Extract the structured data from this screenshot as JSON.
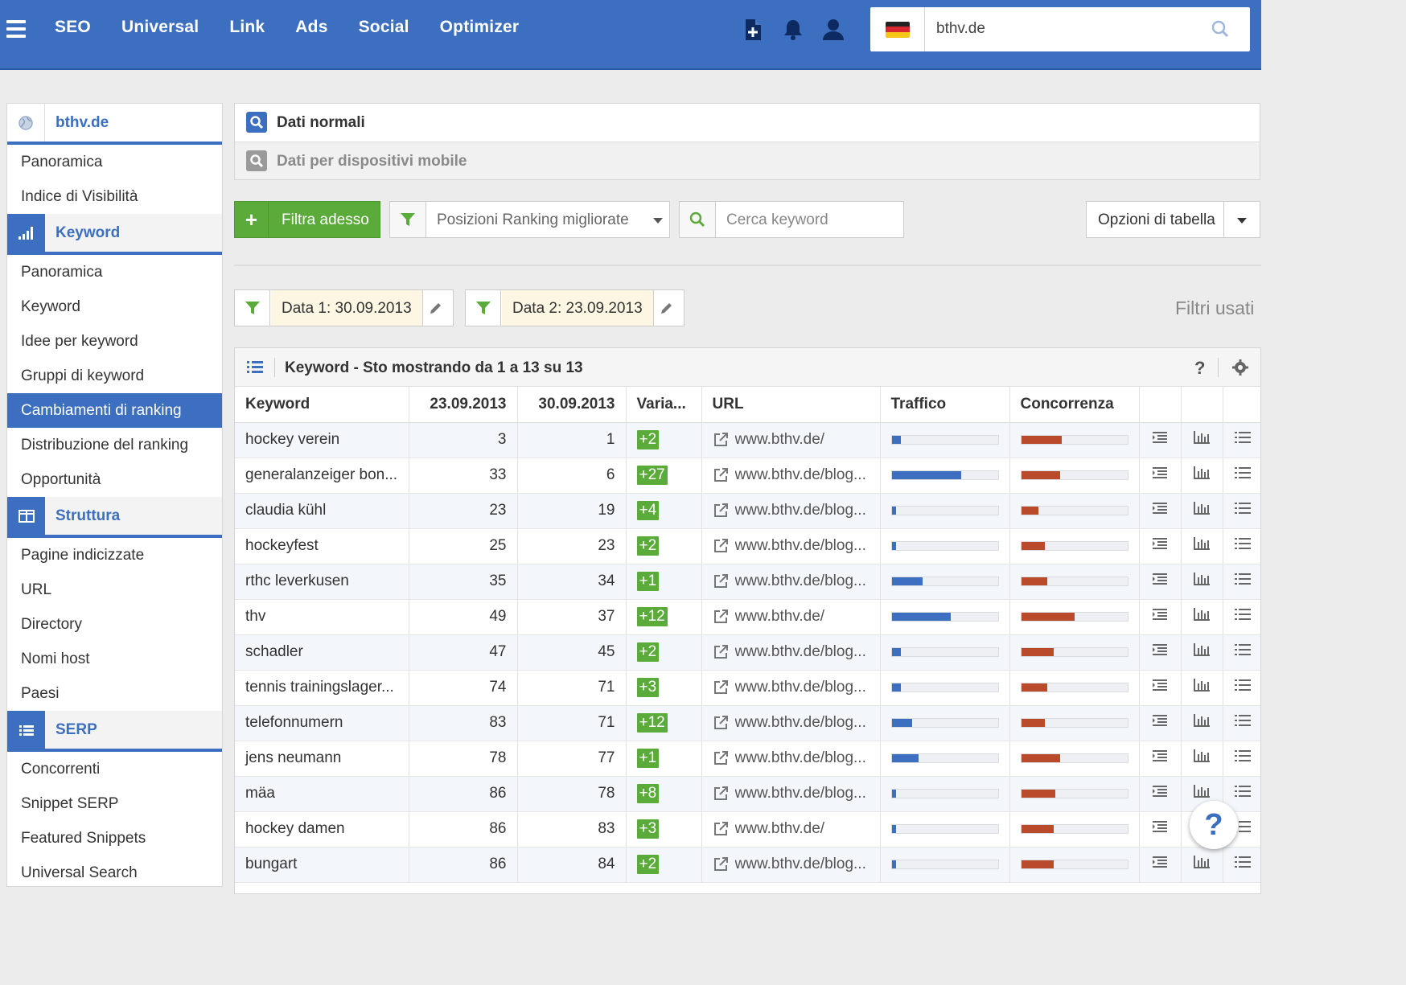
{
  "topnav": {
    "items": [
      "SEO",
      "Universal",
      "Link",
      "Ads",
      "Social",
      "Optimizer"
    ],
    "domain_value": "bthv.de",
    "accent_color": "#3d6fc0"
  },
  "sidebar": {
    "domain": "bthv.de",
    "domain_items": [
      "Panoramica",
      "Indice di Visibilità"
    ],
    "keyword_section": "Keyword",
    "keyword_items": [
      "Panoramica",
      "Keyword",
      "Idee per keyword",
      "Gruppi di keyword",
      "Cambiamenti di ranking",
      "Distribuzione del ranking",
      "Opportunità"
    ],
    "keyword_active": "Cambiamenti di ranking",
    "struttura_section": "Struttura",
    "struttura_items": [
      "Pagine indicizzate",
      "URL",
      "Directory",
      "Nomi host",
      "Paesi"
    ],
    "serp_section": "SERP",
    "serp_items": [
      "Concorrenti",
      "Snippet SERP",
      "Featured Snippets",
      "Universal Search"
    ]
  },
  "device_tabs": {
    "normal": "Dati normali",
    "mobile": "Dati per dispositivi mobile"
  },
  "toolbar": {
    "filter_button": "Filtra adesso",
    "ranking_select": "Posizioni Ranking migliorate",
    "search_placeholder": "Cerca keyword",
    "table_options": "Opzioni di tabella"
  },
  "filters": {
    "date1": "Data 1: 30.09.2013",
    "date2": "Data 2: 23.09.2013",
    "used_label": "Filtri usati"
  },
  "table": {
    "title": "Keyword - Sto mostrando da 1 a 13 su 13",
    "help": "?",
    "columns": [
      "Keyword",
      "23.09.2013",
      "30.09.2013",
      "Varia...",
      "URL",
      "Traffico",
      "Concorrenza"
    ],
    "rows": [
      {
        "keyword": "hockey verein",
        "d1": "3",
        "d2": "1",
        "change": "+2",
        "url": "www.bthv.de/",
        "traffic": 0.08,
        "competition": 0.38
      },
      {
        "keyword": "generalanzeiger bon...",
        "d1": "33",
        "d2": "6",
        "change": "+27",
        "url": "www.bthv.de/blog...",
        "traffic": 0.65,
        "competition": 0.36
      },
      {
        "keyword": "claudia kühl",
        "d1": "23",
        "d2": "19",
        "change": "+4",
        "url": "www.bthv.de/blog...",
        "traffic": 0.04,
        "competition": 0.16
      },
      {
        "keyword": "hockeyfest",
        "d1": "25",
        "d2": "23",
        "change": "+2",
        "url": "www.bthv.de/blog...",
        "traffic": 0.04,
        "competition": 0.22
      },
      {
        "keyword": "rthc leverkusen",
        "d1": "35",
        "d2": "34",
        "change": "+1",
        "url": "www.bthv.de/blog...",
        "traffic": 0.29,
        "competition": 0.24
      },
      {
        "keyword": "thv",
        "d1": "49",
        "d2": "37",
        "change": "+12",
        "url": "www.bthv.de/",
        "traffic": 0.55,
        "competition": 0.5
      },
      {
        "keyword": "schadler",
        "d1": "47",
        "d2": "45",
        "change": "+2",
        "url": "www.bthv.de/blog...",
        "traffic": 0.08,
        "competition": 0.3
      },
      {
        "keyword": "tennis trainingslager...",
        "d1": "74",
        "d2": "71",
        "change": "+3",
        "url": "www.bthv.de/blog...",
        "traffic": 0.08,
        "competition": 0.24
      },
      {
        "keyword": "telefonnumern",
        "d1": "83",
        "d2": "71",
        "change": "+12",
        "url": "www.bthv.de/blog...",
        "traffic": 0.19,
        "competition": 0.22
      },
      {
        "keyword": "jens neumann",
        "d1": "78",
        "d2": "77",
        "change": "+1",
        "url": "www.bthv.de/blog...",
        "traffic": 0.25,
        "competition": 0.36
      },
      {
        "keyword": "mäa",
        "d1": "86",
        "d2": "78",
        "change": "+8",
        "url": "www.bthv.de/blog...",
        "traffic": 0.04,
        "competition": 0.32
      },
      {
        "keyword": "hockey damen",
        "d1": "86",
        "d2": "83",
        "change": "+3",
        "url": "www.bthv.de/",
        "traffic": 0.04,
        "competition": 0.3
      },
      {
        "keyword": "bungart",
        "d1": "86",
        "d2": "84",
        "change": "+2",
        "url": "www.bthv.de/blog...",
        "traffic": 0.04,
        "competition": 0.3
      }
    ],
    "traffic_color": "#3d6fc0",
    "competition_color": "#b94a2c",
    "badge_color": "#5bab3a"
  },
  "help_fab": "?"
}
